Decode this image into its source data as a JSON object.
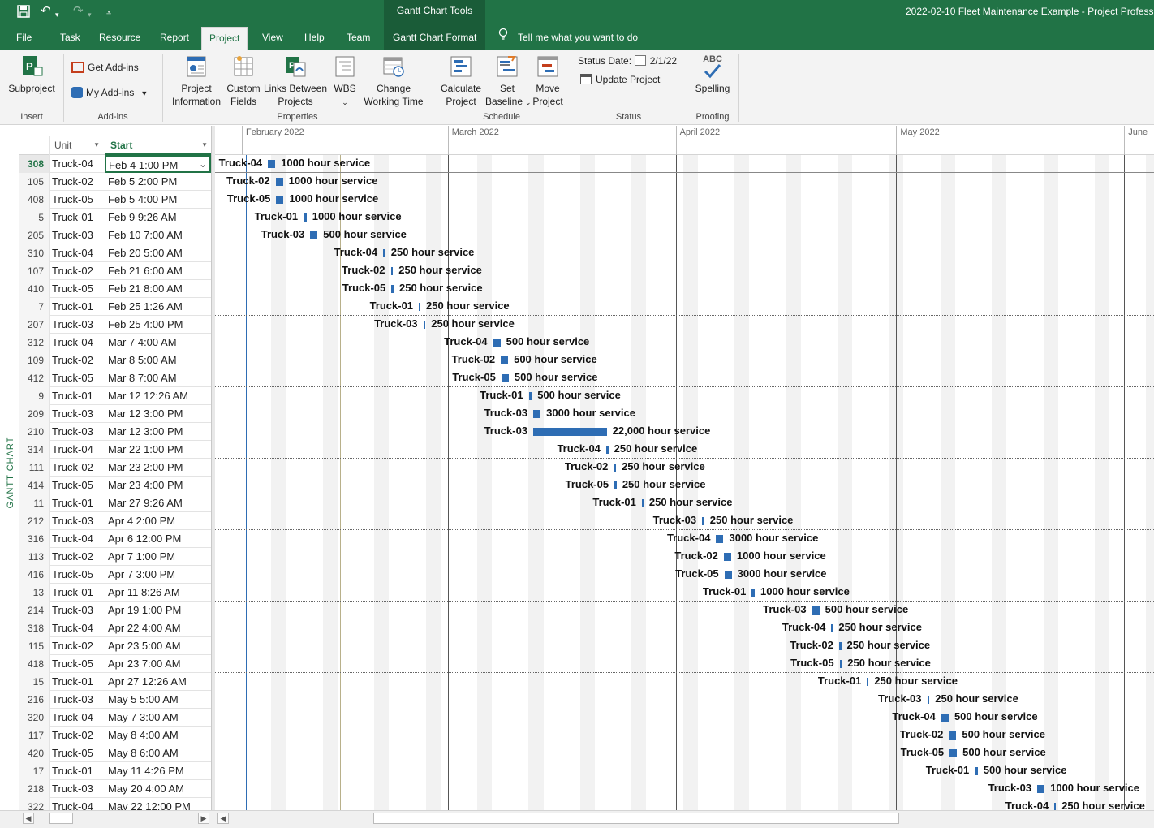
{
  "titlebar": {
    "context_group": "Gantt Chart Tools",
    "doc_title": "2022-02-10 Fleet Maintenance Example  -  Project Professi"
  },
  "tabs": [
    "File",
    "Task",
    "Resource",
    "Report",
    "Project",
    "View",
    "Help",
    "Team",
    "Gantt Chart Format"
  ],
  "active_tab": "Project",
  "tell_me": "Tell me what you want to do",
  "ribbon": {
    "insert": {
      "subproject": "Subproject",
      "label": "Insert"
    },
    "addins": {
      "get": "Get Add-ins",
      "my": "My Add-ins",
      "label": "Add-ins"
    },
    "properties": {
      "project_info_1": "Project",
      "project_info_2": "Information",
      "custom_1": "Custom",
      "custom_2": "Fields",
      "links_1": "Links Between",
      "links_2": "Projects",
      "wbs": "WBS",
      "change_1": "Change",
      "change_2": "Working Time",
      "label": "Properties"
    },
    "schedule": {
      "calc_1": "Calculate",
      "calc_2": "Project",
      "base_1": "Set",
      "base_2": "Baseline",
      "move_1": "Move",
      "move_2": "Project",
      "label": "Schedule"
    },
    "status": {
      "date_label": "Status Date:",
      "date_value": "2/1/22",
      "update": "Update Project",
      "label": "Status"
    },
    "proofing": {
      "abc": "ABC",
      "spelling": "Spelling",
      "label": "Proofing"
    }
  },
  "columns": {
    "unit": "Unit",
    "start": "Start"
  },
  "side_label": "GANTT CHART",
  "months": [
    "February 2022",
    "March 2022",
    "April 2022",
    "May 2022",
    "June"
  ],
  "rows": [
    {
      "id": "308",
      "unit": "Truck-04",
      "start": "Feb 4 1:00 PM",
      "name": "1000 hour service"
    },
    {
      "id": "105",
      "unit": "Truck-02",
      "start": "Feb 5 2:00 PM",
      "name": "1000 hour service"
    },
    {
      "id": "408",
      "unit": "Truck-05",
      "start": "Feb 5 4:00 PM",
      "name": "1000 hour service"
    },
    {
      "id": "5",
      "unit": "Truck-01",
      "start": "Feb 9 9:26 AM",
      "name": "1000 hour service"
    },
    {
      "id": "205",
      "unit": "Truck-03",
      "start": "Feb 10 7:00 AM",
      "name": "500 hour service"
    },
    {
      "id": "310",
      "unit": "Truck-04",
      "start": "Feb 20 5:00 AM",
      "name": "250 hour service"
    },
    {
      "id": "107",
      "unit": "Truck-02",
      "start": "Feb 21 6:00 AM",
      "name": "250 hour service"
    },
    {
      "id": "410",
      "unit": "Truck-05",
      "start": "Feb 21 8:00 AM",
      "name": "250 hour service"
    },
    {
      "id": "7",
      "unit": "Truck-01",
      "start": "Feb 25 1:26 AM",
      "name": "250 hour service"
    },
    {
      "id": "207",
      "unit": "Truck-03",
      "start": "Feb 25 4:00 PM",
      "name": "250 hour service"
    },
    {
      "id": "312",
      "unit": "Truck-04",
      "start": "Mar 7 4:00 AM",
      "name": "500 hour service"
    },
    {
      "id": "109",
      "unit": "Truck-02",
      "start": "Mar 8 5:00 AM",
      "name": "500 hour service"
    },
    {
      "id": "412",
      "unit": "Truck-05",
      "start": "Mar 8 7:00 AM",
      "name": "500 hour service"
    },
    {
      "id": "9",
      "unit": "Truck-01",
      "start": "Mar 12 12:26 AM",
      "name": "500 hour service"
    },
    {
      "id": "209",
      "unit": "Truck-03",
      "start": "Mar 12 3:00 PM",
      "name": "3000 hour service"
    },
    {
      "id": "210",
      "unit": "Truck-03",
      "start": "Mar 12 3:00 PM",
      "name": "22,000 hour service"
    },
    {
      "id": "314",
      "unit": "Truck-04",
      "start": "Mar 22 1:00 PM",
      "name": "250 hour service"
    },
    {
      "id": "111",
      "unit": "Truck-02",
      "start": "Mar 23 2:00 PM",
      "name": "250 hour service"
    },
    {
      "id": "414",
      "unit": "Truck-05",
      "start": "Mar 23 4:00 PM",
      "name": "250 hour service"
    },
    {
      "id": "11",
      "unit": "Truck-01",
      "start": "Mar 27 9:26 AM",
      "name": "250 hour service"
    },
    {
      "id": "212",
      "unit": "Truck-03",
      "start": "Apr 4 2:00 PM",
      "name": "250 hour service"
    },
    {
      "id": "316",
      "unit": "Truck-04",
      "start": "Apr 6 12:00 PM",
      "name": "3000 hour service"
    },
    {
      "id": "113",
      "unit": "Truck-02",
      "start": "Apr 7 1:00 PM",
      "name": "1000 hour service"
    },
    {
      "id": "416",
      "unit": "Truck-05",
      "start": "Apr 7 3:00 PM",
      "name": "3000 hour service"
    },
    {
      "id": "13",
      "unit": "Truck-01",
      "start": "Apr 11 8:26 AM",
      "name": "1000 hour service"
    },
    {
      "id": "214",
      "unit": "Truck-03",
      "start": "Apr 19 1:00 PM",
      "name": "500 hour service"
    },
    {
      "id": "318",
      "unit": "Truck-04",
      "start": "Apr 22 4:00 AM",
      "name": "250 hour service"
    },
    {
      "id": "115",
      "unit": "Truck-02",
      "start": "Apr 23 5:00 AM",
      "name": "250 hour service"
    },
    {
      "id": "418",
      "unit": "Truck-05",
      "start": "Apr 23 7:00 AM",
      "name": "250 hour service"
    },
    {
      "id": "15",
      "unit": "Truck-01",
      "start": "Apr 27 12:26 AM",
      "name": "250 hour service"
    },
    {
      "id": "216",
      "unit": "Truck-03",
      "start": "May 5 5:00 AM",
      "name": "250 hour service"
    },
    {
      "id": "320",
      "unit": "Truck-04",
      "start": "May 7 3:00 AM",
      "name": "500 hour service"
    },
    {
      "id": "117",
      "unit": "Truck-02",
      "start": "May 8 4:00 AM",
      "name": "500 hour service"
    },
    {
      "id": "420",
      "unit": "Truck-05",
      "start": "May 8 6:00 AM",
      "name": "500 hour service"
    },
    {
      "id": "17",
      "unit": "Truck-01",
      "start": "May 11 4:26 PM",
      "name": "500 hour service"
    },
    {
      "id": "218",
      "unit": "Truck-03",
      "start": "May 20 4:00 AM",
      "name": "1000 hour service"
    },
    {
      "id": "322",
      "unit": "Truck-04",
      "start": "May 22 12:00 PM",
      "name": "250 hour service"
    }
  ],
  "durations_days": [
    1,
    1,
    1,
    0.4,
    1,
    0.3,
    0.3,
    0.3,
    0.1,
    0.3,
    1,
    1,
    1,
    0.4,
    1,
    10,
    0.3,
    0.3,
    0.3,
    0.1,
    0.3,
    1,
    1,
    1,
    0.4,
    1,
    0.1,
    0.3,
    0.3,
    0.1,
    0.3,
    1,
    1,
    1,
    0.4,
    1,
    0.1
  ],
  "colors": {
    "brand": "#217346",
    "bar": "#2e6db4"
  }
}
